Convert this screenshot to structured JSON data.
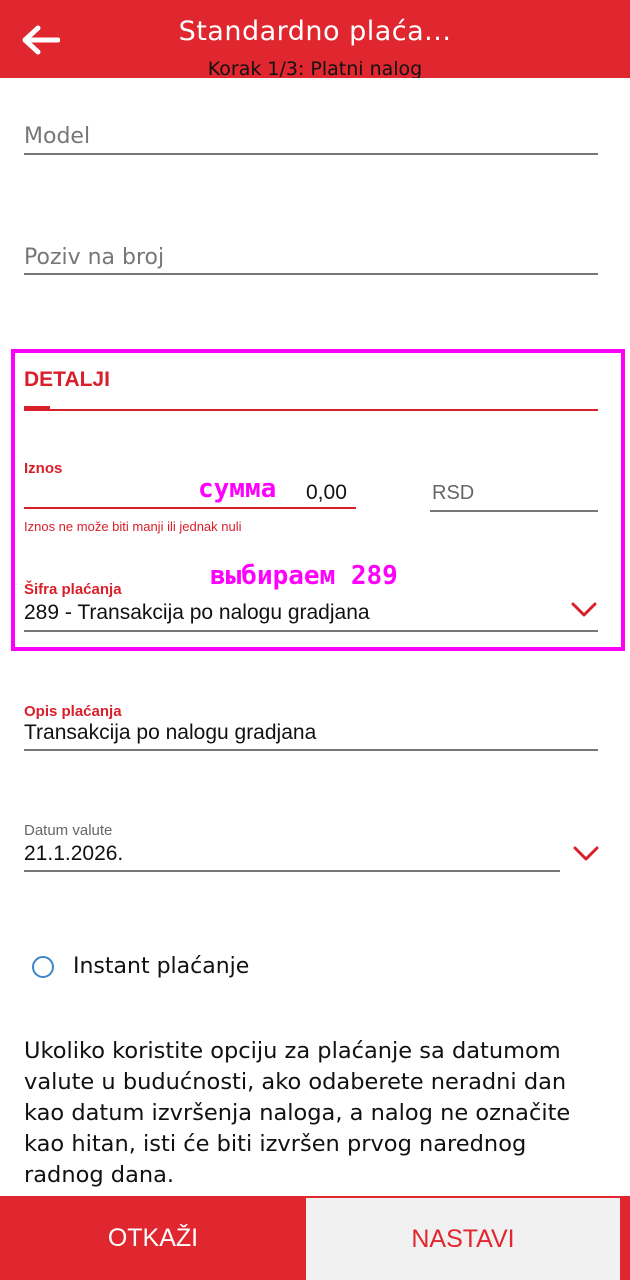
{
  "header": {
    "title": "Standardno plaća...",
    "subtitle": "Korak 1/3: Platni nalog",
    "back_icon": "arrow-left-icon"
  },
  "form": {
    "model": {
      "placeholder": "Model"
    },
    "poziv": {
      "placeholder": "Poziv na broj"
    },
    "details": {
      "section_title": "DETALJI",
      "amount": {
        "label": "Iznos",
        "value": "0,00",
        "currency": "RSD",
        "error": "Iznos ne može biti manji ili jednak nuli"
      },
      "payment_code": {
        "label": "Šifra plaćanja",
        "value": "289 - Transakcija po nalogu gradjana"
      }
    },
    "description": {
      "label": "Opis plaćanja",
      "value": "Transakcija po nalogu gradjana"
    },
    "value_date": {
      "label": "Datum valute",
      "value": "21.1.2026."
    },
    "instant": {
      "label": "Instant plaćanje"
    },
    "note": "Ukoliko koristite opciju za plaćanje sa datumom valute u budućnosti, ako odaberete neradni dan kao datum izvršenja naloga, a nalog ne označite kao hitan, isti će biti izvršen prvog narednog radnog dana."
  },
  "annotations": {
    "amount_note": "сумма",
    "code_note": "выбираем 289",
    "highlight_color": "#ff00ff"
  },
  "footer": {
    "cancel_label": "OTKAŽI",
    "next_label": "NASTAVI"
  },
  "colors": {
    "brand_red": "#e0262e",
    "radio_blue": "#3a86c8"
  }
}
